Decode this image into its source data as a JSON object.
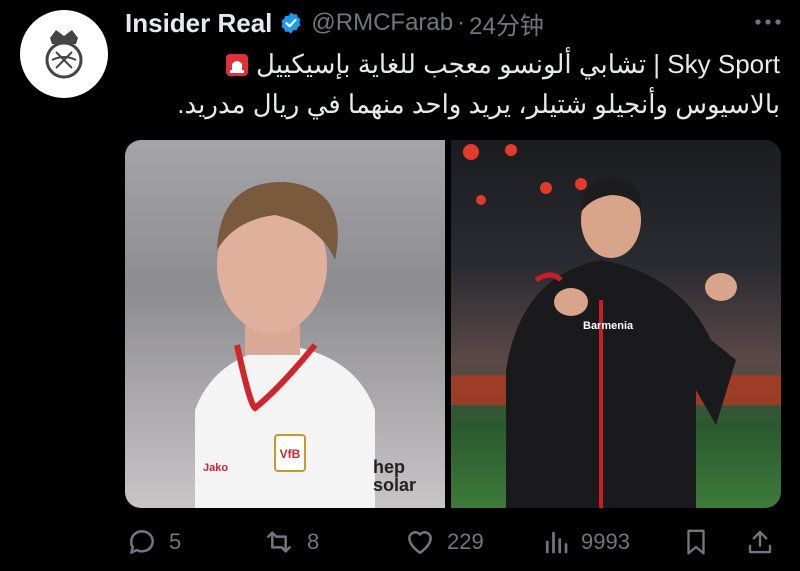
{
  "tweet": {
    "author_name": "Insider Real",
    "handle": "@RMCFarab",
    "separator": "·",
    "time": "24分钟",
    "text_line1": "Sky Sport | تشابي ألونسو معجب للغاية بإسيكييل",
    "text_line2": "بالاسيوس وأنجيلو شتيلر، يريد واحد منهما في ريال مدريد.",
    "badge_icon": "rotating-light-icon",
    "verified_color": "#1d9bf0"
  },
  "media": {
    "photo_left": {
      "jersey_text": "hep solar",
      "sponsor_small": "Jako"
    },
    "photo_right": {
      "jacket_text": "Barmenia"
    }
  },
  "actions": {
    "replies": "5",
    "retweets": "8",
    "likes": "229",
    "views": "9993"
  },
  "colors": {
    "muted": "#71767b",
    "text": "#e7e9ea",
    "background": "#000000"
  }
}
